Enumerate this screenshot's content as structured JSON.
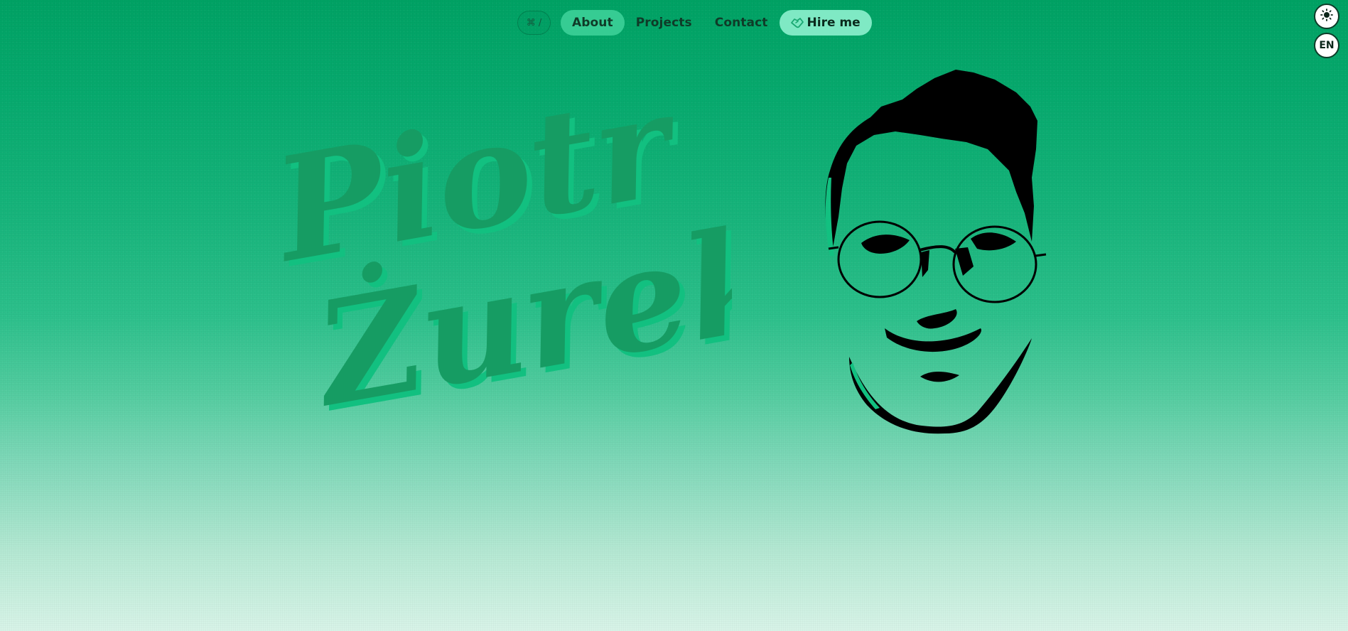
{
  "nav": {
    "shortcut_label": "⌘ /",
    "items": [
      {
        "label": "About",
        "active": true
      },
      {
        "label": "Projects",
        "active": false
      },
      {
        "label": "Contact",
        "active": false
      }
    ],
    "hire_label": "Hire me",
    "hire_icon": "handshake-icon"
  },
  "controls": {
    "theme_icon": "sun-icon",
    "language_label": "EN"
  },
  "hero": {
    "first_name": "Piotr",
    "last_name": "Żurek",
    "portrait_icon": "face-portrait-illustration"
  },
  "colors": {
    "background_top": "#00a264",
    "background_bottom": "#d8f4e8",
    "name_fill": "#169c63",
    "name_shadow": "#12c080",
    "active_nav": "#36cc93",
    "hire_bg": "#7fe9c4"
  }
}
